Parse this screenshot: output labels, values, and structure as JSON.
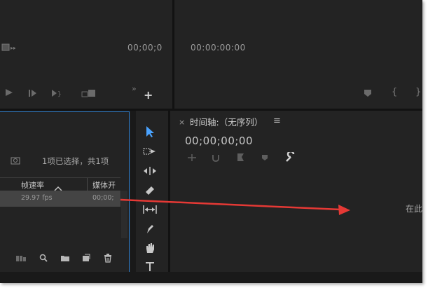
{
  "source_monitor": {
    "timecode": "00;00;0"
  },
  "program_monitor": {
    "timecode": "00:00:00:00"
  },
  "project_panel": {
    "selection_info": "1项已选择，共1项",
    "columns": [
      {
        "label": "帧速率"
      },
      {
        "label": "媒体开"
      }
    ],
    "row": {
      "frame_rate": "29.97 fps",
      "media_start": "00;00;"
    }
  },
  "timeline": {
    "close_glyph": "×",
    "title": "时间轴:（无序列）",
    "menu_glyph": "≡",
    "timecode": "00;00;00;00",
    "drop_hint": "在此"
  },
  "icons": {
    "source_controls": [
      "mark-in-icon",
      "step-back-icon",
      "step-forward-icon",
      "insert-icon",
      "add-button-icon"
    ],
    "program_controls": [
      "marker-icon",
      "mark-in-bracket-icon",
      "mark-out-bracket-icon"
    ],
    "project_bottom": [
      "freeform-view-icon",
      "find-icon",
      "new-bin-icon",
      "new-item-icon",
      "delete-icon"
    ],
    "tools": [
      "selection-tool",
      "track-select-tool",
      "ripple-edit-tool",
      "razor-tool",
      "slip-tool",
      "pen-tool",
      "hand-tool",
      "type-tool"
    ]
  },
  "colors": {
    "panel_bg": "#232323",
    "separator": "#121212",
    "accent_blue": "#2b78c5",
    "arrow_red": "#e53935",
    "selected_tool": "#4aa3ff"
  }
}
